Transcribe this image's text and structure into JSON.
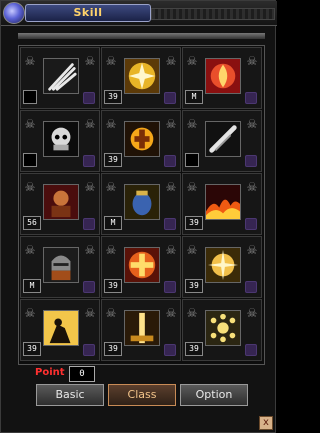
{
  "title": "Skill",
  "point": {
    "label": "Point",
    "value": "0"
  },
  "tabs": [
    {
      "label": "Basic",
      "active": false
    },
    {
      "label": "Class",
      "active": true
    },
    {
      "label": "Option",
      "active": false
    }
  ],
  "close_label": "x",
  "skills": [
    {
      "level": "",
      "icon": "claw-slash-icon"
    },
    {
      "level": "39",
      "icon": "golden-cross-icon"
    },
    {
      "level": "M",
      "icon": "flame-aura-icon"
    },
    {
      "level": "",
      "icon": "skull-helmet-icon"
    },
    {
      "level": "39",
      "icon": "glowing-emblem-icon"
    },
    {
      "level": "",
      "icon": "silver-blade-icon"
    },
    {
      "level": "56",
      "icon": "armored-knight-icon"
    },
    {
      "level": "M",
      "icon": "blue-urn-icon"
    },
    {
      "level": "39",
      "icon": "fire-wave-icon"
    },
    {
      "level": "M",
      "icon": "helmeted-warrior-icon"
    },
    {
      "level": "39",
      "icon": "holy-cross-icon"
    },
    {
      "level": "39",
      "icon": "starburst-icon"
    },
    {
      "level": "39",
      "icon": "dark-rider-icon"
    },
    {
      "level": "39",
      "icon": "light-pillar-icon"
    },
    {
      "level": "39",
      "icon": "gold-orbs-icon"
    }
  ],
  "colors": {
    "point_label": "#ff3030",
    "active_tab_text": "#f2c38a",
    "title_text": "#ffd36a"
  }
}
